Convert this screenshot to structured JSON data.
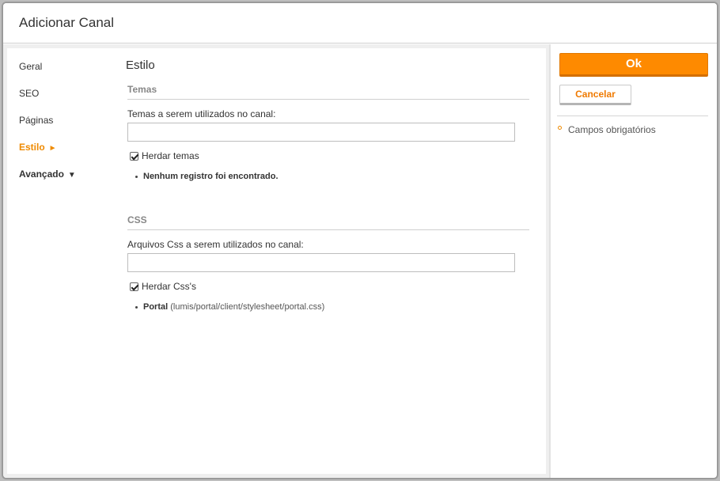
{
  "dialog": {
    "title": "Adicionar Canal"
  },
  "nav": {
    "items": [
      {
        "label": "Geral"
      },
      {
        "label": "SEO"
      },
      {
        "label": "Páginas"
      },
      {
        "label": "Estilo",
        "arrow": "►"
      },
      {
        "label": "Avançado",
        "arrow": "▼"
      }
    ]
  },
  "main": {
    "section_title": "Estilo",
    "temas": {
      "header": "Temas",
      "field_label": "Temas a serem utilizados no canal:",
      "input_value": "",
      "checkbox_label": "Herdar temas",
      "checkbox_checked": true,
      "empty_message": "Nenhum registro foi encontrado."
    },
    "css": {
      "header": "CSS",
      "field_label": "Arquivos Css a serem utilizados no canal:",
      "input_value": "",
      "checkbox_label": "Herdar Css's",
      "checkbox_checked": true,
      "items": [
        {
          "name": "Portal",
          "path": "(lumis/portal/client/stylesheet/portal.css)"
        }
      ]
    }
  },
  "sidebar": {
    "ok_label": "Ok",
    "cancel_label": "Cancelar",
    "required_note": "Campos obrigatórios"
  },
  "colors": {
    "accent": "#fe8a00",
    "accent_text": "#ef8a00"
  }
}
